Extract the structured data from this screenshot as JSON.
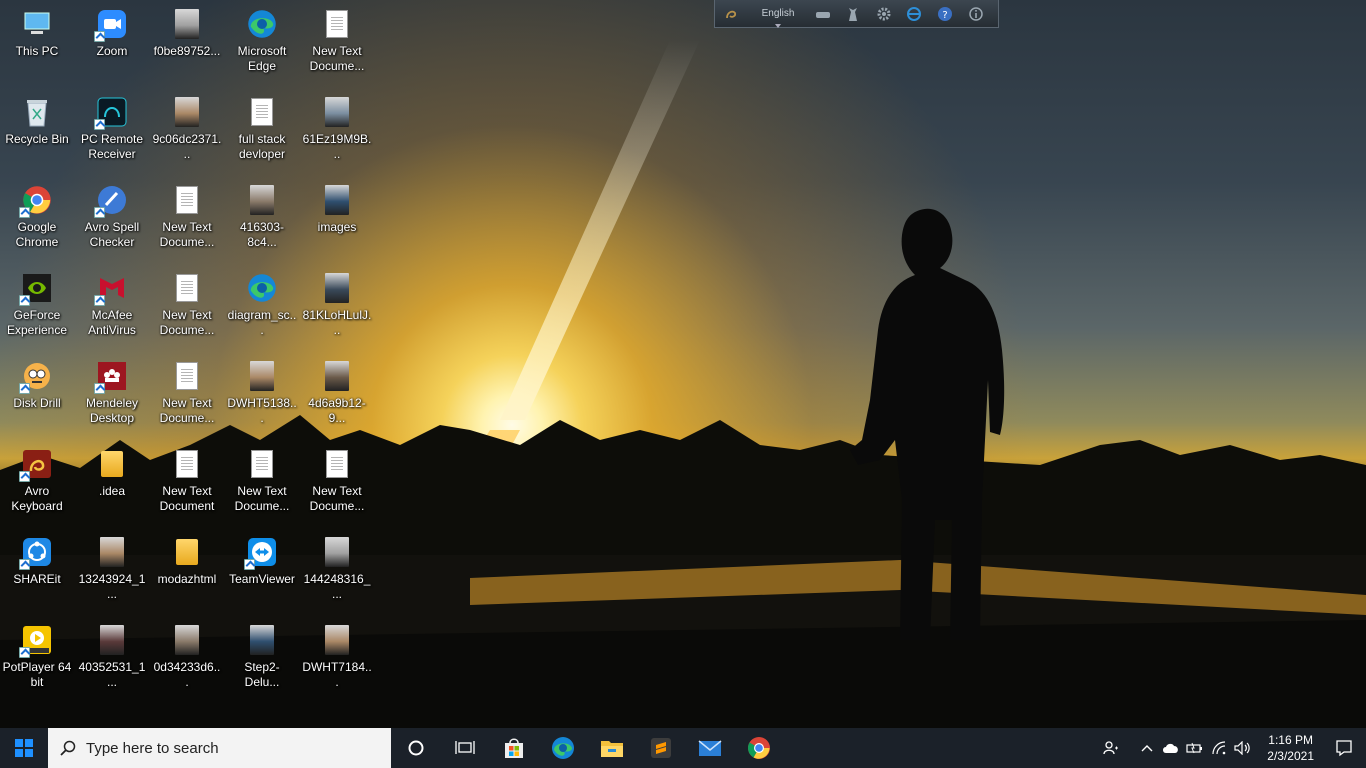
{
  "desktop": {
    "icons": [
      {
        "label": "This PC",
        "icon": "computer-icon"
      },
      {
        "label": "Zoom",
        "icon": "zoom-icon"
      },
      {
        "label": "f0be89752...",
        "icon": "image-file-icon"
      },
      {
        "label": "Microsoft Edge",
        "icon": "edge-icon"
      },
      {
        "label": "New Text Docume...",
        "icon": "text-document-icon"
      },
      {
        "label": "Recycle Bin",
        "icon": "recycle-bin-icon"
      },
      {
        "label": "PC Remote Receiver",
        "icon": "pc-remote-icon"
      },
      {
        "label": "9c06dc2371...",
        "icon": "image-file-icon"
      },
      {
        "label": "full stack devloper",
        "icon": "text-document-icon"
      },
      {
        "label": "61Ez19M9B...",
        "icon": "image-file-icon"
      },
      {
        "label": "Google Chrome",
        "icon": "chrome-icon"
      },
      {
        "label": "Avro Spell Checker",
        "icon": "avro-spell-icon"
      },
      {
        "label": "New Text Docume...",
        "icon": "text-document-icon"
      },
      {
        "label": "416303-8c4...",
        "icon": "image-file-icon"
      },
      {
        "label": "images",
        "icon": "image-file-icon"
      },
      {
        "label": "GeForce Experience",
        "icon": "geforce-icon"
      },
      {
        "label": "McAfee AntiVirus",
        "icon": "mcafee-icon"
      },
      {
        "label": "New Text Docume...",
        "icon": "text-document-icon"
      },
      {
        "label": "diagram_sc...",
        "icon": "edge-icon"
      },
      {
        "label": "81KLoHLulJ...",
        "icon": "image-file-icon"
      },
      {
        "label": "Disk Drill",
        "icon": "disk-drill-icon"
      },
      {
        "label": "Mendeley Desktop",
        "icon": "mendeley-icon"
      },
      {
        "label": "New Text Docume...",
        "icon": "text-document-icon"
      },
      {
        "label": "DWHT5138...",
        "icon": "image-file-icon"
      },
      {
        "label": "4d6a9b12-9...",
        "icon": "image-file-icon"
      },
      {
        "label": "Avro Keyboard",
        "icon": "avro-keyboard-icon"
      },
      {
        "label": ".idea",
        "icon": "folder-icon"
      },
      {
        "label": "New Text Document",
        "icon": "text-document-icon"
      },
      {
        "label": "New Text Docume...",
        "icon": "text-document-icon"
      },
      {
        "label": "New Text Docume...",
        "icon": "text-document-icon"
      },
      {
        "label": "SHAREit",
        "icon": "shareit-icon"
      },
      {
        "label": "13243924_1...",
        "icon": "image-file-icon"
      },
      {
        "label": "modazhtml",
        "icon": "folder-icon"
      },
      {
        "label": "TeamViewer",
        "icon": "teamviewer-icon"
      },
      {
        "label": "144248316_...",
        "icon": "image-file-icon"
      },
      {
        "label": "PotPlayer 64 bit",
        "icon": "potplayer-icon"
      },
      {
        "label": "40352531_1...",
        "icon": "image-file-icon"
      },
      {
        "label": "0d34233d6...",
        "icon": "image-file-icon"
      },
      {
        "label": "Step2-Delu...",
        "icon": "image-file-icon"
      },
      {
        "label": "DWHT7184...",
        "icon": "image-file-icon"
      }
    ]
  },
  "language_bar": {
    "language": "English"
  },
  "taskbar": {
    "search_placeholder": "Type here to search",
    "pinned": [
      "cortana-icon",
      "task-view-icon",
      "microsoft-store-icon",
      "edge-icon",
      "file-explorer-icon",
      "sublime-text-icon",
      "mail-icon",
      "chrome-icon"
    ],
    "clock_time": "1:16 PM",
    "clock_date": "2/3/2021"
  },
  "colors": {
    "taskbar_bg": "#1b2129",
    "search_bg": "#f3f3f3",
    "accent_blue": "#1e88e5"
  }
}
